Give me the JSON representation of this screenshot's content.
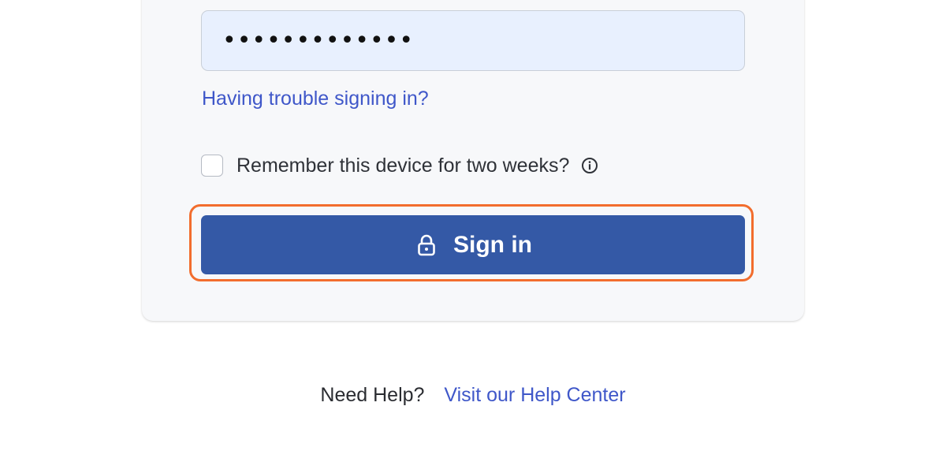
{
  "login": {
    "password_value": "•••••••••••••",
    "trouble_link": "Having trouble signing in?",
    "remember_label": "Remember this device for two weeks?",
    "remember_checked": false,
    "signin_label": "Sign in"
  },
  "help": {
    "text": "Need Help?",
    "link": "Visit our Help Center"
  },
  "icons": {
    "info": "info-circle-icon",
    "lock": "lock-icon"
  },
  "colors": {
    "primary_button": "#3459a6",
    "link": "#3f57c9",
    "highlight": "#f26d2d",
    "field_background": "#e8f0fe"
  }
}
